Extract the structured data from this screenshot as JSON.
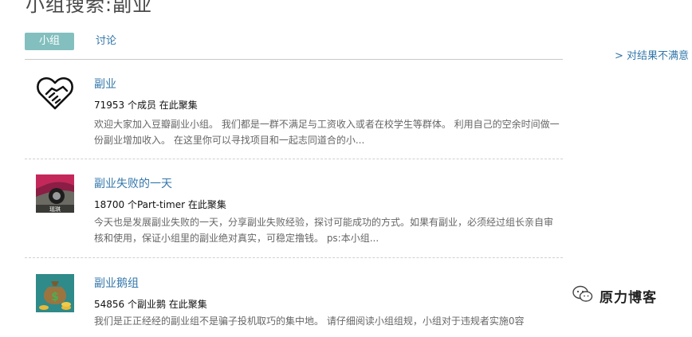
{
  "page": {
    "title": "小组搜索:副业"
  },
  "tabs": [
    {
      "label": "小组",
      "active": true
    },
    {
      "label": "讨论",
      "active": false
    }
  ],
  "feedback_link": "> 对结果不满意",
  "results": [
    {
      "name": "副业",
      "meta": "71953 个成员 在此聚集",
      "desc": "欢迎大家加入豆瓣副业小组。 我们都是一群不满足与工资收入或者在校学生等群体。 利用自己的空余时间做一份副业增加收入。 在这里你可以寻找项目和一起志同道合的小...",
      "avatar_icon": "handshake-heart-icon"
    },
    {
      "name": "副业失败的一天",
      "meta": "18700 个Part-timer 在此聚集",
      "desc": "今天也是发展副业失败的一天，分享副业失败经验，探讨可能成功的方式。如果有副业，必须经过组长亲自审核和使用，保证小组里的副业绝对真实，可稳定撸钱。 ps:本小组...",
      "avatar_icon": "car-wheel-photo-icon",
      "avatar_caption": "瑶琪"
    },
    {
      "name": "副业鹅组",
      "meta": "54856 个副业鹅 在此聚集",
      "desc": "我们是正正经经的副业组不是骗子投机取巧的集中地。 请仔细阅读小组组规，小组对于违规者实施0容",
      "avatar_icon": "money-bag-icon"
    }
  ],
  "watermark": {
    "text": "原力博客",
    "icon": "wechat-icon"
  },
  "colors": {
    "accent": "#83bfbf",
    "link": "#3377aa"
  }
}
